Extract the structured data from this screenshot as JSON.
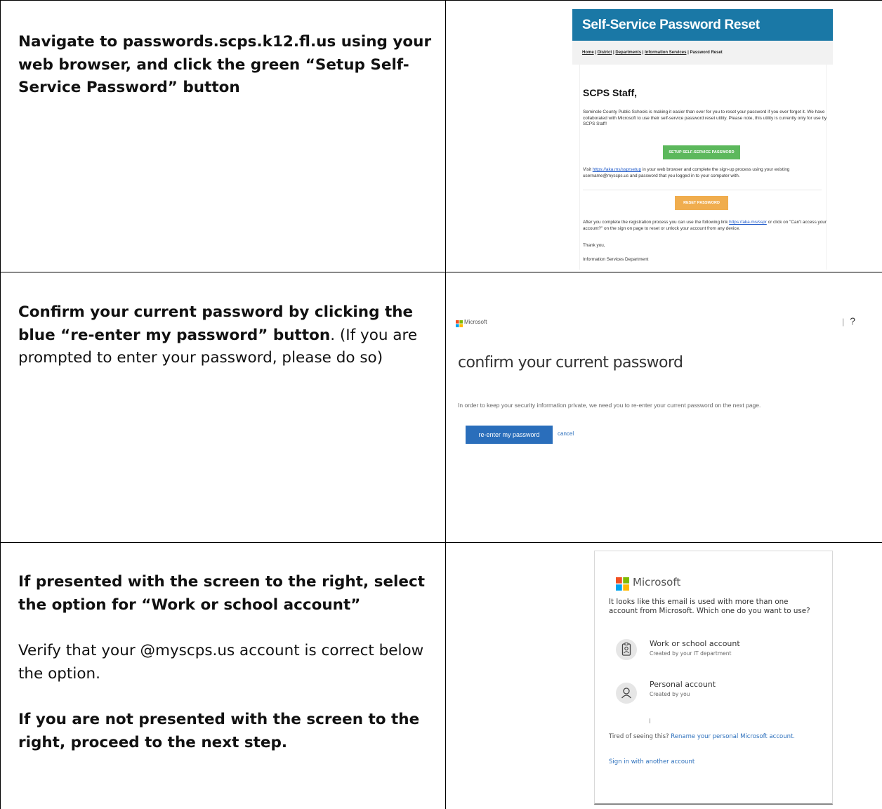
{
  "rows": [
    {
      "instruction_bold": "Navigate to passwords.scps.k12.fl.us using your web browser, and click the green “Setup Self-Service Password” button"
    },
    {
      "instruction_bold": "Confirm your current password by clicking the blue “re-enter my password” button",
      "instruction_normal": ".  (If you are prompted to enter your password, please do so)"
    },
    {
      "instruction_bold_1": "If presented with the screen to the right, select the option for “Work or school account”",
      "instruction_normal": "Verify that your @myscps.us account is correct below the option.",
      "instruction_bold_2": "If you are not presented with the screen to the right, proceed to the next step."
    }
  ],
  "sspr_page": {
    "header_title": "Self-Service Password Reset",
    "breadcrumb": [
      "Home",
      "District",
      "Departments",
      "Information Services",
      "Password Reset"
    ],
    "greeting": "SCPS Staff,",
    "intro": "Seminole County Public Schools is making it easier than ever for you to reset your password if you ever forget it. We have collaborated with Microsoft to use their self-service password reset utility. Please note, this utility is currently only for use by SCPS Staff!",
    "setup_button": "SETUP SELF-SERVICE PASSWORD",
    "visit_prefix": "Visit ",
    "visit_link": "https://aka.ms/ssprsetup",
    "visit_suffix": " in your web browser and complete the sign-up process using your existing username@myscps.us and password that you logged in to your computer with.",
    "reset_button": "RESET PASSWORD",
    "after_prefix": "After you complete the registration process you can use the following link ",
    "after_link": "https://aka.ms/sspr",
    "after_suffix": " or click on \"Can't access your account?\" on the sign on page to reset or unlock your account from any device.",
    "thanks": "Thank you,",
    "signature": "Information Services Department"
  },
  "confirm_page": {
    "brand": "Microsoft",
    "pipe": "|",
    "help": "?",
    "title": "confirm your current password",
    "description": "In order to keep your security information private, we need you to re-enter your current password on the next page.",
    "reenter_button": "re-enter my password",
    "cancel_link": "cancel"
  },
  "account_picker": {
    "brand": "Microsoft",
    "question": "It looks like this email is used with more than one account from Microsoft. Which one do you want to use?",
    "options": [
      {
        "title": "Work or school account",
        "subtitle": "Created by your IT department",
        "icon": "badge-icon"
      },
      {
        "title": "Personal account",
        "subtitle": "Created by you",
        "icon": "person-icon"
      }
    ],
    "tired_prefix": "Tired of seeing this? ",
    "tired_link": "Rename your personal Microsoft account.",
    "signin_link": "Sign in with another account"
  },
  "colors": {
    "sspr_header": "#1a78a6",
    "setup_button": "#5cb85c",
    "reset_button": "#f0ad4e",
    "ms_blue_button": "#2a6ebb"
  }
}
